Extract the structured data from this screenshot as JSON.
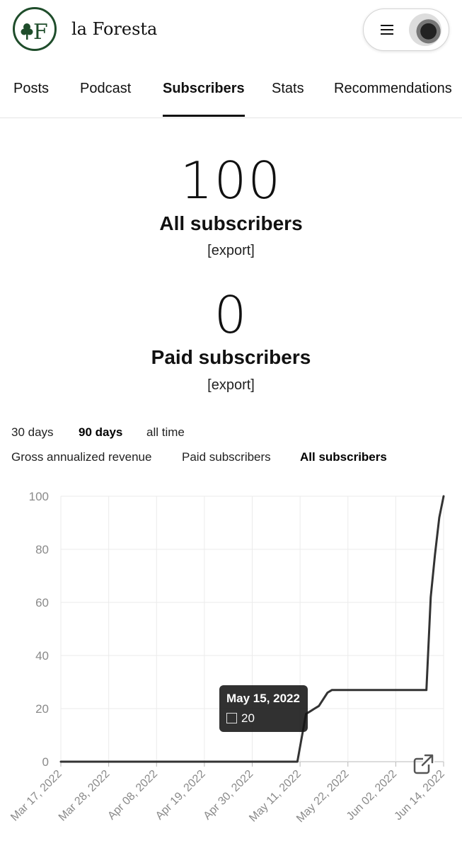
{
  "header": {
    "brand": "la Foresta",
    "logo_letter": "F",
    "menu_icon": "hamburger-menu-icon",
    "avatar": "user-avatar"
  },
  "tabs": [
    {
      "label": "Posts",
      "active": false
    },
    {
      "label": "Podcast",
      "active": false
    },
    {
      "label": "Subscribers",
      "active": true
    },
    {
      "label": "Stats",
      "active": false
    },
    {
      "label": "Recommendations",
      "active": false
    }
  ],
  "stats": {
    "all": {
      "value": "100",
      "label": "All subscribers",
      "export": "[export]"
    },
    "paid": {
      "value": "0",
      "label": "Paid subscribers",
      "export": "[export]"
    }
  },
  "ranges": [
    {
      "label": "30 days",
      "active": false
    },
    {
      "label": "90 days",
      "active": true
    },
    {
      "label": "all time",
      "active": false
    }
  ],
  "metrics": [
    {
      "label": "Gross annualized revenue",
      "active": false
    },
    {
      "label": "Paid subscribers",
      "active": false
    },
    {
      "label": "All subscribers",
      "active": true
    }
  ],
  "tooltip": {
    "date": "May 15, 2022",
    "value": "20"
  },
  "chart_data": {
    "type": "line",
    "series": [
      {
        "values": [
          {
            "x": "2022-03-17",
            "y": 0
          },
          {
            "x": "2022-05-11",
            "y": 0
          },
          {
            "x": "2022-05-13",
            "y": 18
          },
          {
            "x": "2022-05-14",
            "y": 19
          },
          {
            "x": "2022-05-15",
            "y": 20
          },
          {
            "x": "2022-05-16",
            "y": 21
          },
          {
            "x": "2022-05-18",
            "y": 26
          },
          {
            "x": "2022-05-19",
            "y": 27
          },
          {
            "x": "2022-06-10",
            "y": 27
          },
          {
            "x": "2022-06-11",
            "y": 62
          },
          {
            "x": "2022-06-12",
            "y": 78
          },
          {
            "x": "2022-06-13",
            "y": 92
          },
          {
            "x": "2022-06-14",
            "y": 100
          }
        ]
      }
    ],
    "x_ticks": [
      "Mar 17, 2022",
      "Mar 28, 2022",
      "Apr 08, 2022",
      "Apr 19, 2022",
      "Apr 30, 2022",
      "May 11, 2022",
      "May 22, 2022",
      "Jun 02, 2022",
      "Jun 14, 2022"
    ],
    "y_ticks": [
      0,
      20,
      40,
      60,
      80,
      100
    ],
    "ylim": [
      0,
      100
    ],
    "xlim": [
      "2022-03-17",
      "2022-06-14"
    ],
    "grid": true,
    "line_color": "#333333",
    "grid_color": "#ebebeb"
  },
  "colors": {
    "brand_green": "#1f4d2b",
    "text": "#111111",
    "tooltip_bg": "#1a1a1a"
  },
  "expand_icon": "open-in-new-icon"
}
